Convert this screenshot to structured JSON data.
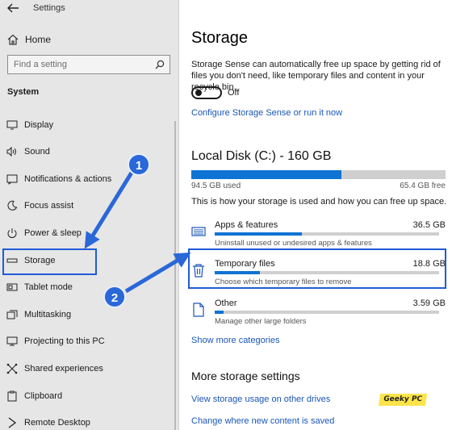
{
  "window": {
    "title": "Settings"
  },
  "sidebar": {
    "home_label": "Home",
    "search_placeholder": "Find a setting",
    "section_label": "System",
    "items": [
      {
        "label": "Display",
        "icon": "display-icon"
      },
      {
        "label": "Sound",
        "icon": "sound-icon"
      },
      {
        "label": "Notifications & actions",
        "icon": "notifications-icon"
      },
      {
        "label": "Focus assist",
        "icon": "focus-assist-icon"
      },
      {
        "label": "Power & sleep",
        "icon": "power-icon"
      },
      {
        "label": "Storage",
        "icon": "storage-icon",
        "selected": true
      },
      {
        "label": "Tablet mode",
        "icon": "tablet-mode-icon"
      },
      {
        "label": "Multitasking",
        "icon": "multitasking-icon"
      },
      {
        "label": "Projecting to this PC",
        "icon": "projecting-icon"
      },
      {
        "label": "Shared experiences",
        "icon": "shared-experiences-icon"
      },
      {
        "label": "Clipboard",
        "icon": "clipboard-icon"
      },
      {
        "label": "Remote Desktop",
        "icon": "remote-desktop-icon"
      }
    ]
  },
  "main": {
    "title": "Storage",
    "sense_description": "Storage Sense can automatically free up space by getting rid of files you don't need, like temporary files and content in your recycle bin.",
    "toggle_state": "Off",
    "configure_link": "Configure Storage Sense or run it now",
    "disk": {
      "title": "Local Disk (C:) - 160 GB",
      "used_label": "94.5 GB used",
      "free_label": "65.4 GB free",
      "used_fraction": 0.59
    },
    "how_text": "This is how your storage is used and how you can free up space.",
    "categories": [
      {
        "name": "Apps & features",
        "size": "36.5 GB",
        "description": "Uninstall unused or undesired apps & features",
        "fill_fraction": 0.39,
        "icon": "apps-features-icon"
      },
      {
        "name": "Temporary files",
        "size": "18.8 GB",
        "description": "Choose which temporary files to remove",
        "fill_fraction": 0.2,
        "icon": "trash-icon"
      },
      {
        "name": "Other",
        "size": "3.59 GB",
        "description": "Manage other large folders",
        "fill_fraction": 0.04,
        "icon": "file-icon"
      }
    ],
    "more_categories_link": "Show more categories",
    "more_settings_title": "More storage settings",
    "usage_link": "View storage usage on other drives",
    "change_link": "Change where new content is saved"
  },
  "annotations": {
    "callout_1": "1",
    "callout_2": "2",
    "logo_text": "Geeky PC",
    "accent_color": "#1f5bd8"
  }
}
